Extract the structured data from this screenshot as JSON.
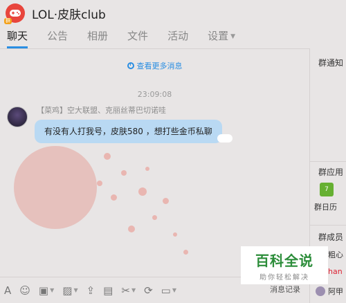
{
  "window": {
    "title": "LOL·皮肤club",
    "avatar_tag": "群"
  },
  "tabs": [
    {
      "label": "聊天",
      "active": true
    },
    {
      "label": "公告"
    },
    {
      "label": "相册"
    },
    {
      "label": "文件"
    },
    {
      "label": "活动"
    },
    {
      "label": "设置"
    }
  ],
  "chat": {
    "more_messages": "查看更多消息",
    "timestamp": "23:09:08",
    "message": {
      "sender": "【菜鸡】空大联盟、克丽丝蒂巴切诺哇",
      "text": "有没有人打我号，皮肤580 ，想打些金币私聊"
    }
  },
  "toolbar": {
    "history": "消息记录",
    "icons": [
      "font-icon",
      "emoji-icon",
      "gift-card-icon",
      "image-icon",
      "upload-icon",
      "gift-icon",
      "scissors-icon",
      "shake-icon",
      "screen-icon"
    ]
  },
  "sidebar": {
    "notice_title": "群通知",
    "apps_title": "群应用",
    "calendar_label": "群日历",
    "calendar_day": "7",
    "members_title": "群成员",
    "members": [
      "粗心",
      "han",
      "阿甲"
    ]
  },
  "watermark": {
    "main": "百科全说",
    "sub": "助你轻松解决"
  },
  "colors": {
    "accent": "#2a8ee2",
    "bubble": "#b9d9f3",
    "calendar": "#66b032"
  }
}
